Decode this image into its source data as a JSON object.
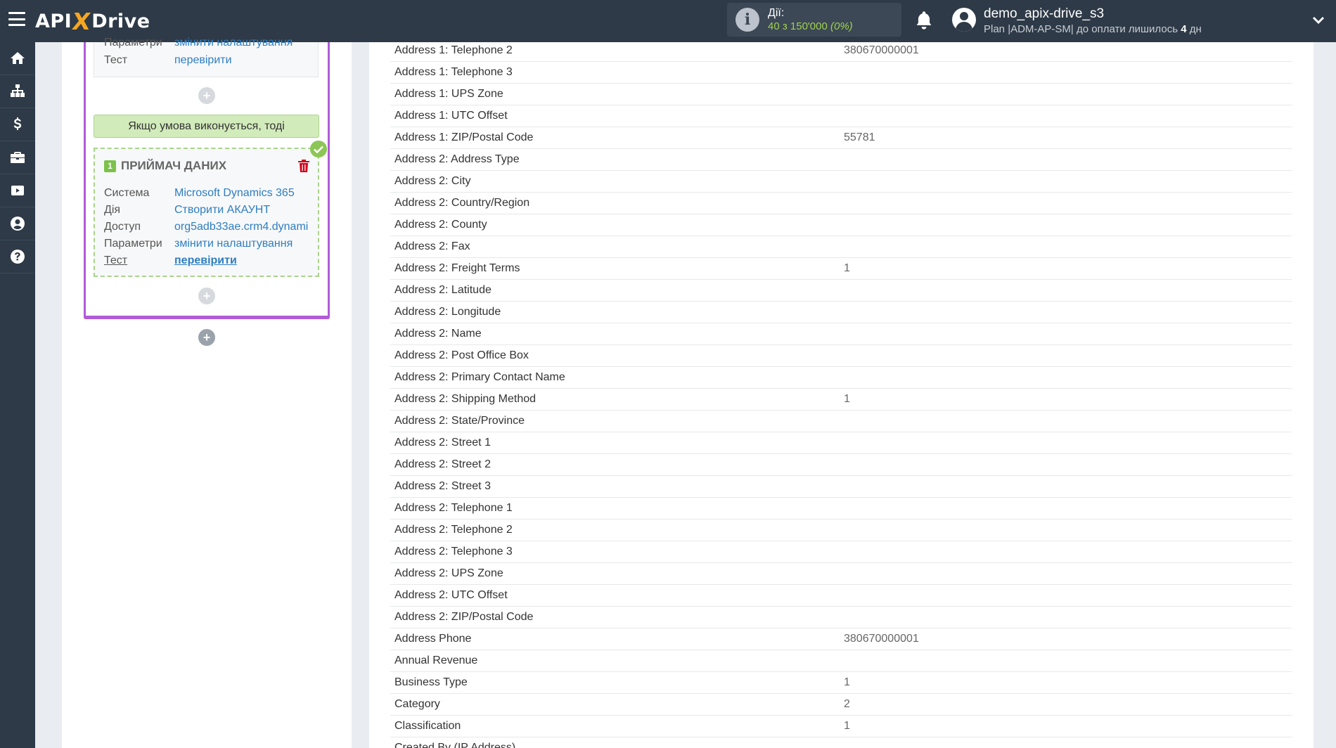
{
  "header": {
    "logo": {
      "left": "API",
      "x": "X",
      "right": "Drive"
    },
    "actions": {
      "label": "Дії:",
      "count": "40",
      "separator": " з ",
      "total": "150'000",
      "percent": "(0%)"
    },
    "user": {
      "name": "demo_apix-drive_s3",
      "plan_prefix": "Plan |ADM-AP-SM| до оплати лишилось ",
      "days": "4",
      "days_suffix": " дн"
    }
  },
  "sidebar": {
    "items": [
      "home-icon",
      "sitemap-icon",
      "dollar-icon",
      "briefcase-icon",
      "youtube-icon",
      "user-circle-icon",
      "question-icon"
    ]
  },
  "left": {
    "prev": {
      "params_label": "Параметри",
      "params_value": "змінити налаштування",
      "test_label": "Тест",
      "test_value": "перевірити"
    },
    "condition": "Якщо умова виконується, тоді",
    "receiver": {
      "number": "1",
      "title": "ПРИЙМАЧ ДАНИХ",
      "system_label": "Система",
      "system_value": "Microsoft Dynamics 365",
      "action_label": "Дія",
      "action_value": "Створити АКАУНТ",
      "access_label": "Доступ",
      "access_value": "org5adb33ae.crm4.dynami",
      "params_label": "Параметри",
      "params_value": "змінити налаштування",
      "test_label": "Тест",
      "test_value": "перевірити"
    },
    "plus": "+"
  },
  "fields": [
    {
      "name": "Address 1: Telephone 2",
      "value": "380670000001"
    },
    {
      "name": "Address 1: Telephone 3",
      "value": ""
    },
    {
      "name": "Address 1: UPS Zone",
      "value": ""
    },
    {
      "name": "Address 1: UTC Offset",
      "value": ""
    },
    {
      "name": "Address 1: ZIP/Postal Code",
      "value": "55781"
    },
    {
      "name": "Address 2: Address Type",
      "value": ""
    },
    {
      "name": "Address 2: City",
      "value": ""
    },
    {
      "name": "Address 2: Country/Region",
      "value": ""
    },
    {
      "name": "Address 2: County",
      "value": ""
    },
    {
      "name": "Address 2: Fax",
      "value": ""
    },
    {
      "name": "Address 2: Freight Terms",
      "value": "1"
    },
    {
      "name": "Address 2: Latitude",
      "value": ""
    },
    {
      "name": "Address 2: Longitude",
      "value": ""
    },
    {
      "name": "Address 2: Name",
      "value": ""
    },
    {
      "name": "Address 2: Post Office Box",
      "value": ""
    },
    {
      "name": "Address 2: Primary Contact Name",
      "value": ""
    },
    {
      "name": "Address 2: Shipping Method",
      "value": "1"
    },
    {
      "name": "Address 2: State/Province",
      "value": ""
    },
    {
      "name": "Address 2: Street 1",
      "value": ""
    },
    {
      "name": "Address 2: Street 2",
      "value": ""
    },
    {
      "name": "Address 2: Street 3",
      "value": ""
    },
    {
      "name": "Address 2: Telephone 1",
      "value": ""
    },
    {
      "name": "Address 2: Telephone 2",
      "value": ""
    },
    {
      "name": "Address 2: Telephone 3",
      "value": ""
    },
    {
      "name": "Address 2: UPS Zone",
      "value": ""
    },
    {
      "name": "Address 2: UTC Offset",
      "value": ""
    },
    {
      "name": "Address 2: ZIP/Postal Code",
      "value": ""
    },
    {
      "name": "Address Phone",
      "value": "380670000001"
    },
    {
      "name": "Annual Revenue",
      "value": ""
    },
    {
      "name": "Business Type",
      "value": "1"
    },
    {
      "name": "Category",
      "value": "2"
    },
    {
      "name": "Classification",
      "value": "1"
    },
    {
      "name": "Created By (IP Address)",
      "value": ""
    }
  ]
}
